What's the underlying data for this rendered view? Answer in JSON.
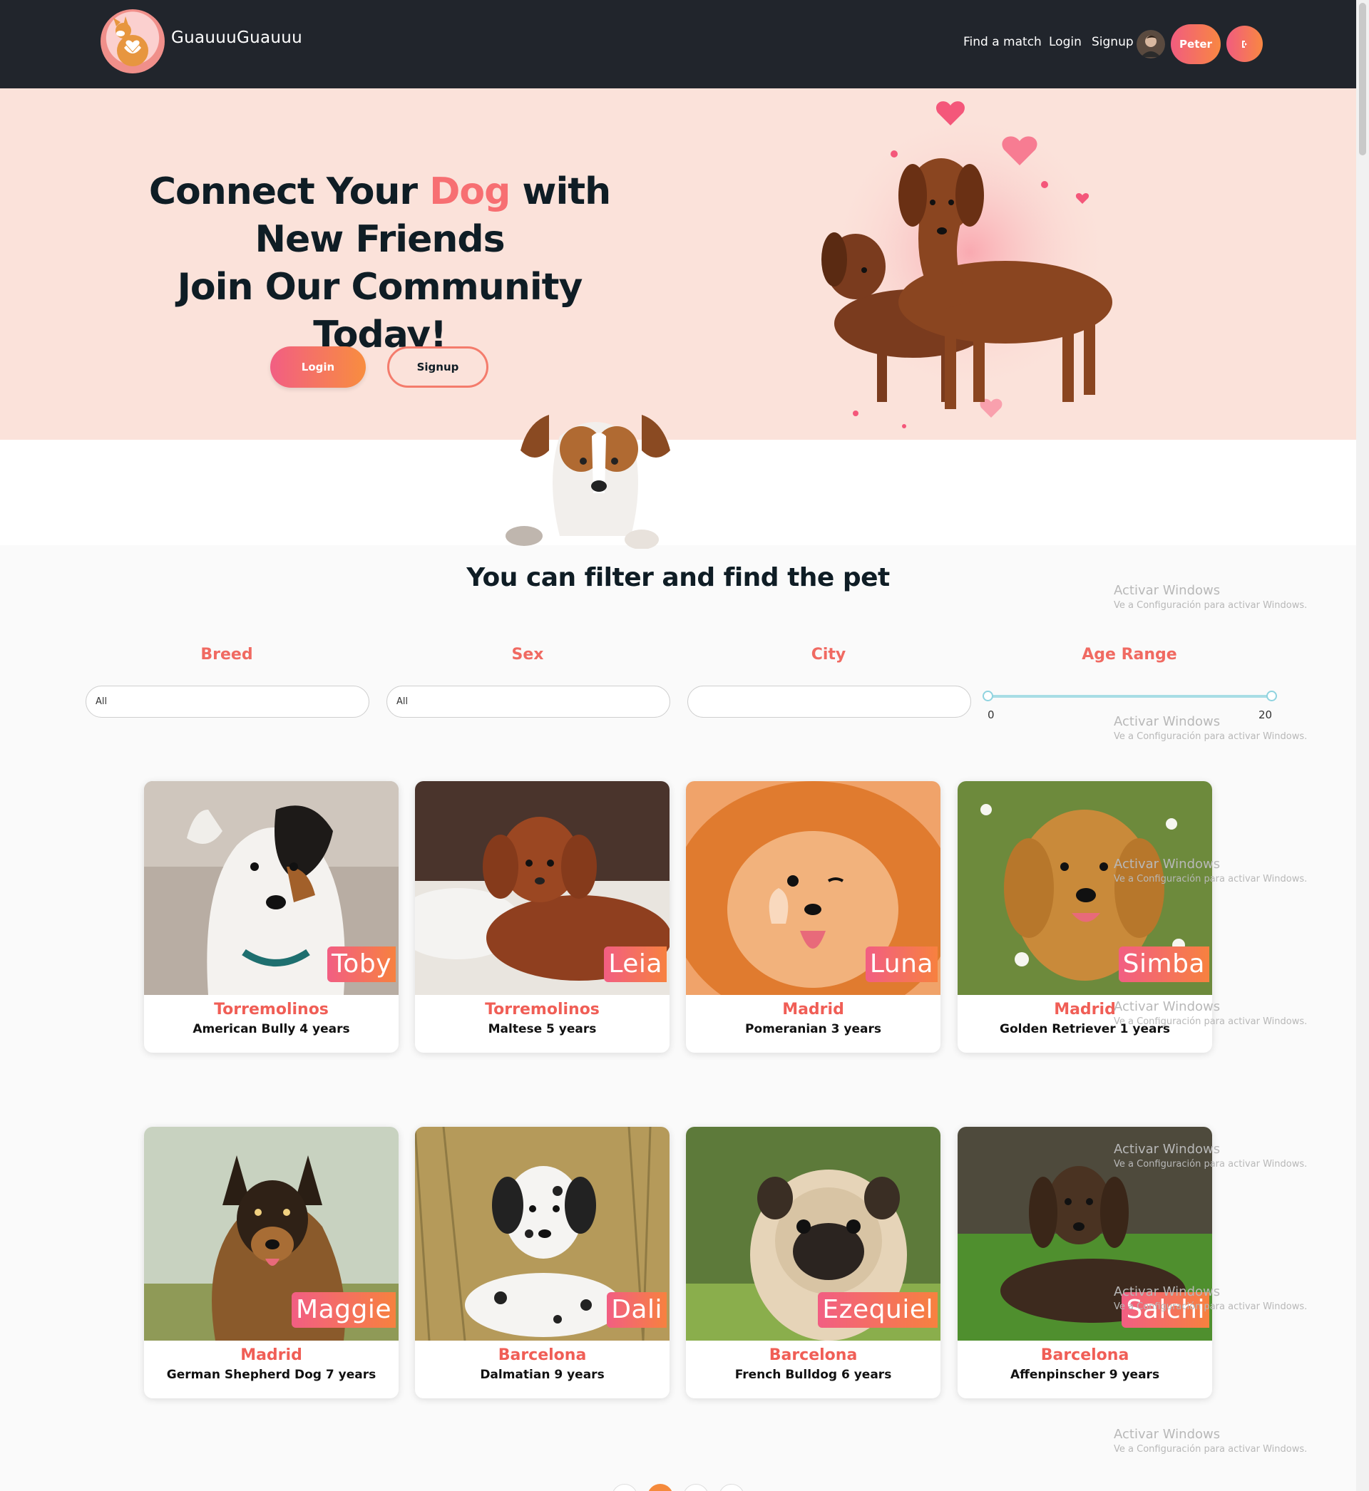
{
  "navbar": {
    "brand": "GuauuuGuauuu",
    "links": [
      "Find a match",
      "Login",
      "Signup"
    ],
    "user_button": "Peter",
    "logout_icon": "logout-icon"
  },
  "hero": {
    "title_part1": "Connect Your ",
    "title_accent": "Dog",
    "title_part2": " with New Friends",
    "title_line2": "Join Our Community Today!",
    "login_label": "Login",
    "signup_label": "Signup"
  },
  "filters": {
    "heading": "You can filter and find the pet",
    "breed_label": "Breed",
    "breed_value": "All",
    "sex_label": "Sex",
    "sex_value": "All",
    "city_label": "City",
    "city_value": "",
    "age_label": "Age Range",
    "age_min": "0",
    "age_max": "20"
  },
  "dogs": [
    {
      "name": "Toby",
      "city": "Torremolinos",
      "info": "American Bully 4 years"
    },
    {
      "name": "Leia",
      "city": "Torremolinos",
      "info": "Maltese 5 years"
    },
    {
      "name": "Luna",
      "city": "Madrid",
      "info": "Pomeranian 3 years"
    },
    {
      "name": "Simba",
      "city": "Madrid",
      "info": "Golden Retriever 1 years"
    },
    {
      "name": "Maggie",
      "city": "Madrid",
      "info": "German Shepherd Dog 7 years"
    },
    {
      "name": "Dali",
      "city": "Barcelona",
      "info": "Dalmatian 9 years"
    },
    {
      "name": "Ezequiel",
      "city": "Barcelona",
      "info": "French Bulldog 6 years"
    },
    {
      "name": "Salchi",
      "city": "Barcelona",
      "info": "Affenpinscher 9 years"
    }
  ],
  "watermark": {
    "line1": "Activar Windows",
    "line2": "Ve a Configuración para activar Windows."
  },
  "colors": {
    "accent": "#f76f72",
    "navbar_bg": "#21252c",
    "hero_bg": "#fbe2da",
    "gradient_start": "#f25e83",
    "gradient_end": "#f88742"
  }
}
